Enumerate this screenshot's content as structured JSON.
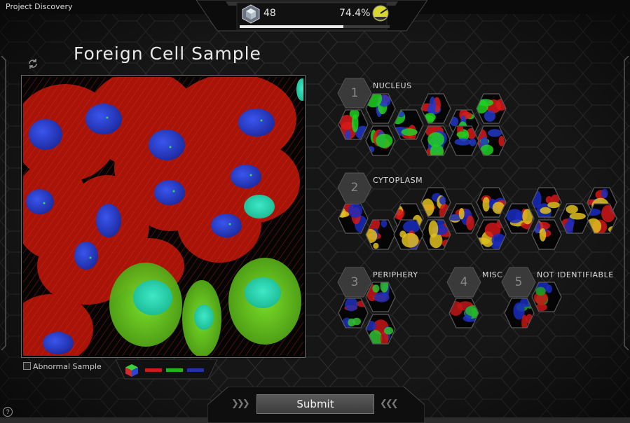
{
  "app": {
    "title": "Project Discovery"
  },
  "header": {
    "level": "48",
    "accuracy": "74.4%",
    "progress_fraction": 0.69
  },
  "sample": {
    "title": "Foreign Cell Sample",
    "abnormal_label": "Abnormal Sample"
  },
  "channels": {
    "red": "#cc1a1a",
    "green": "#22b322",
    "blue": "#2233aa"
  },
  "categories": [
    {
      "number": "1",
      "label": "NUCLEUS",
      "thumb_count": 10
    },
    {
      "number": "2",
      "label": "CYTOPLASM",
      "thumb_count": 15
    },
    {
      "number": "3",
      "label": "PERIPHERY",
      "thumb_count": 3
    },
    {
      "number": "4",
      "label": "MISC",
      "thumb_count": 1
    },
    {
      "number": "5",
      "label": "NOT IDENTIFIABLE",
      "thumb_count": 2
    }
  ],
  "footer": {
    "submit_label": "Submit",
    "help_label": "?"
  },
  "icons": {
    "refresh": "refresh-icon",
    "rank": "rank-icon",
    "gauge": "accuracy-gauge-icon",
    "cube": "channel-cube-icon",
    "help": "help-icon"
  }
}
